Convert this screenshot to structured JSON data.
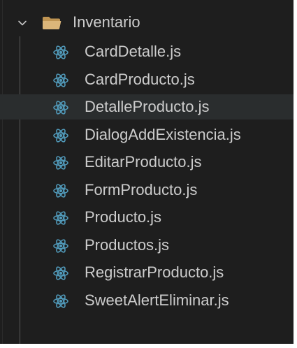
{
  "explorer": {
    "folder": {
      "name": "Inventario",
      "expanded": true,
      "icon": "folder-open-icon"
    },
    "files": [
      {
        "name": "CardDetalle.js",
        "icon": "react-icon"
      },
      {
        "name": "CardProducto.js",
        "icon": "react-icon"
      },
      {
        "name": "DetalleProducto.js",
        "icon": "react-icon",
        "selected": true
      },
      {
        "name": "DialogAddExistencia.js",
        "icon": "react-icon"
      },
      {
        "name": "EditarProducto.js",
        "icon": "react-icon"
      },
      {
        "name": "FormProducto.js",
        "icon": "react-icon"
      },
      {
        "name": "Producto.js",
        "icon": "react-icon"
      },
      {
        "name": "Productos.js",
        "icon": "react-icon"
      },
      {
        "name": "RegistrarProducto.js",
        "icon": "react-icon"
      },
      {
        "name": "SweetAlertEliminar.js",
        "icon": "react-icon"
      }
    ]
  },
  "colors": {
    "background": "#1e1e1e",
    "selected_row": "#2a2d2e",
    "text": "#cccccc",
    "react_icon": "#519aba",
    "folder_icon": "#dcb67a"
  }
}
